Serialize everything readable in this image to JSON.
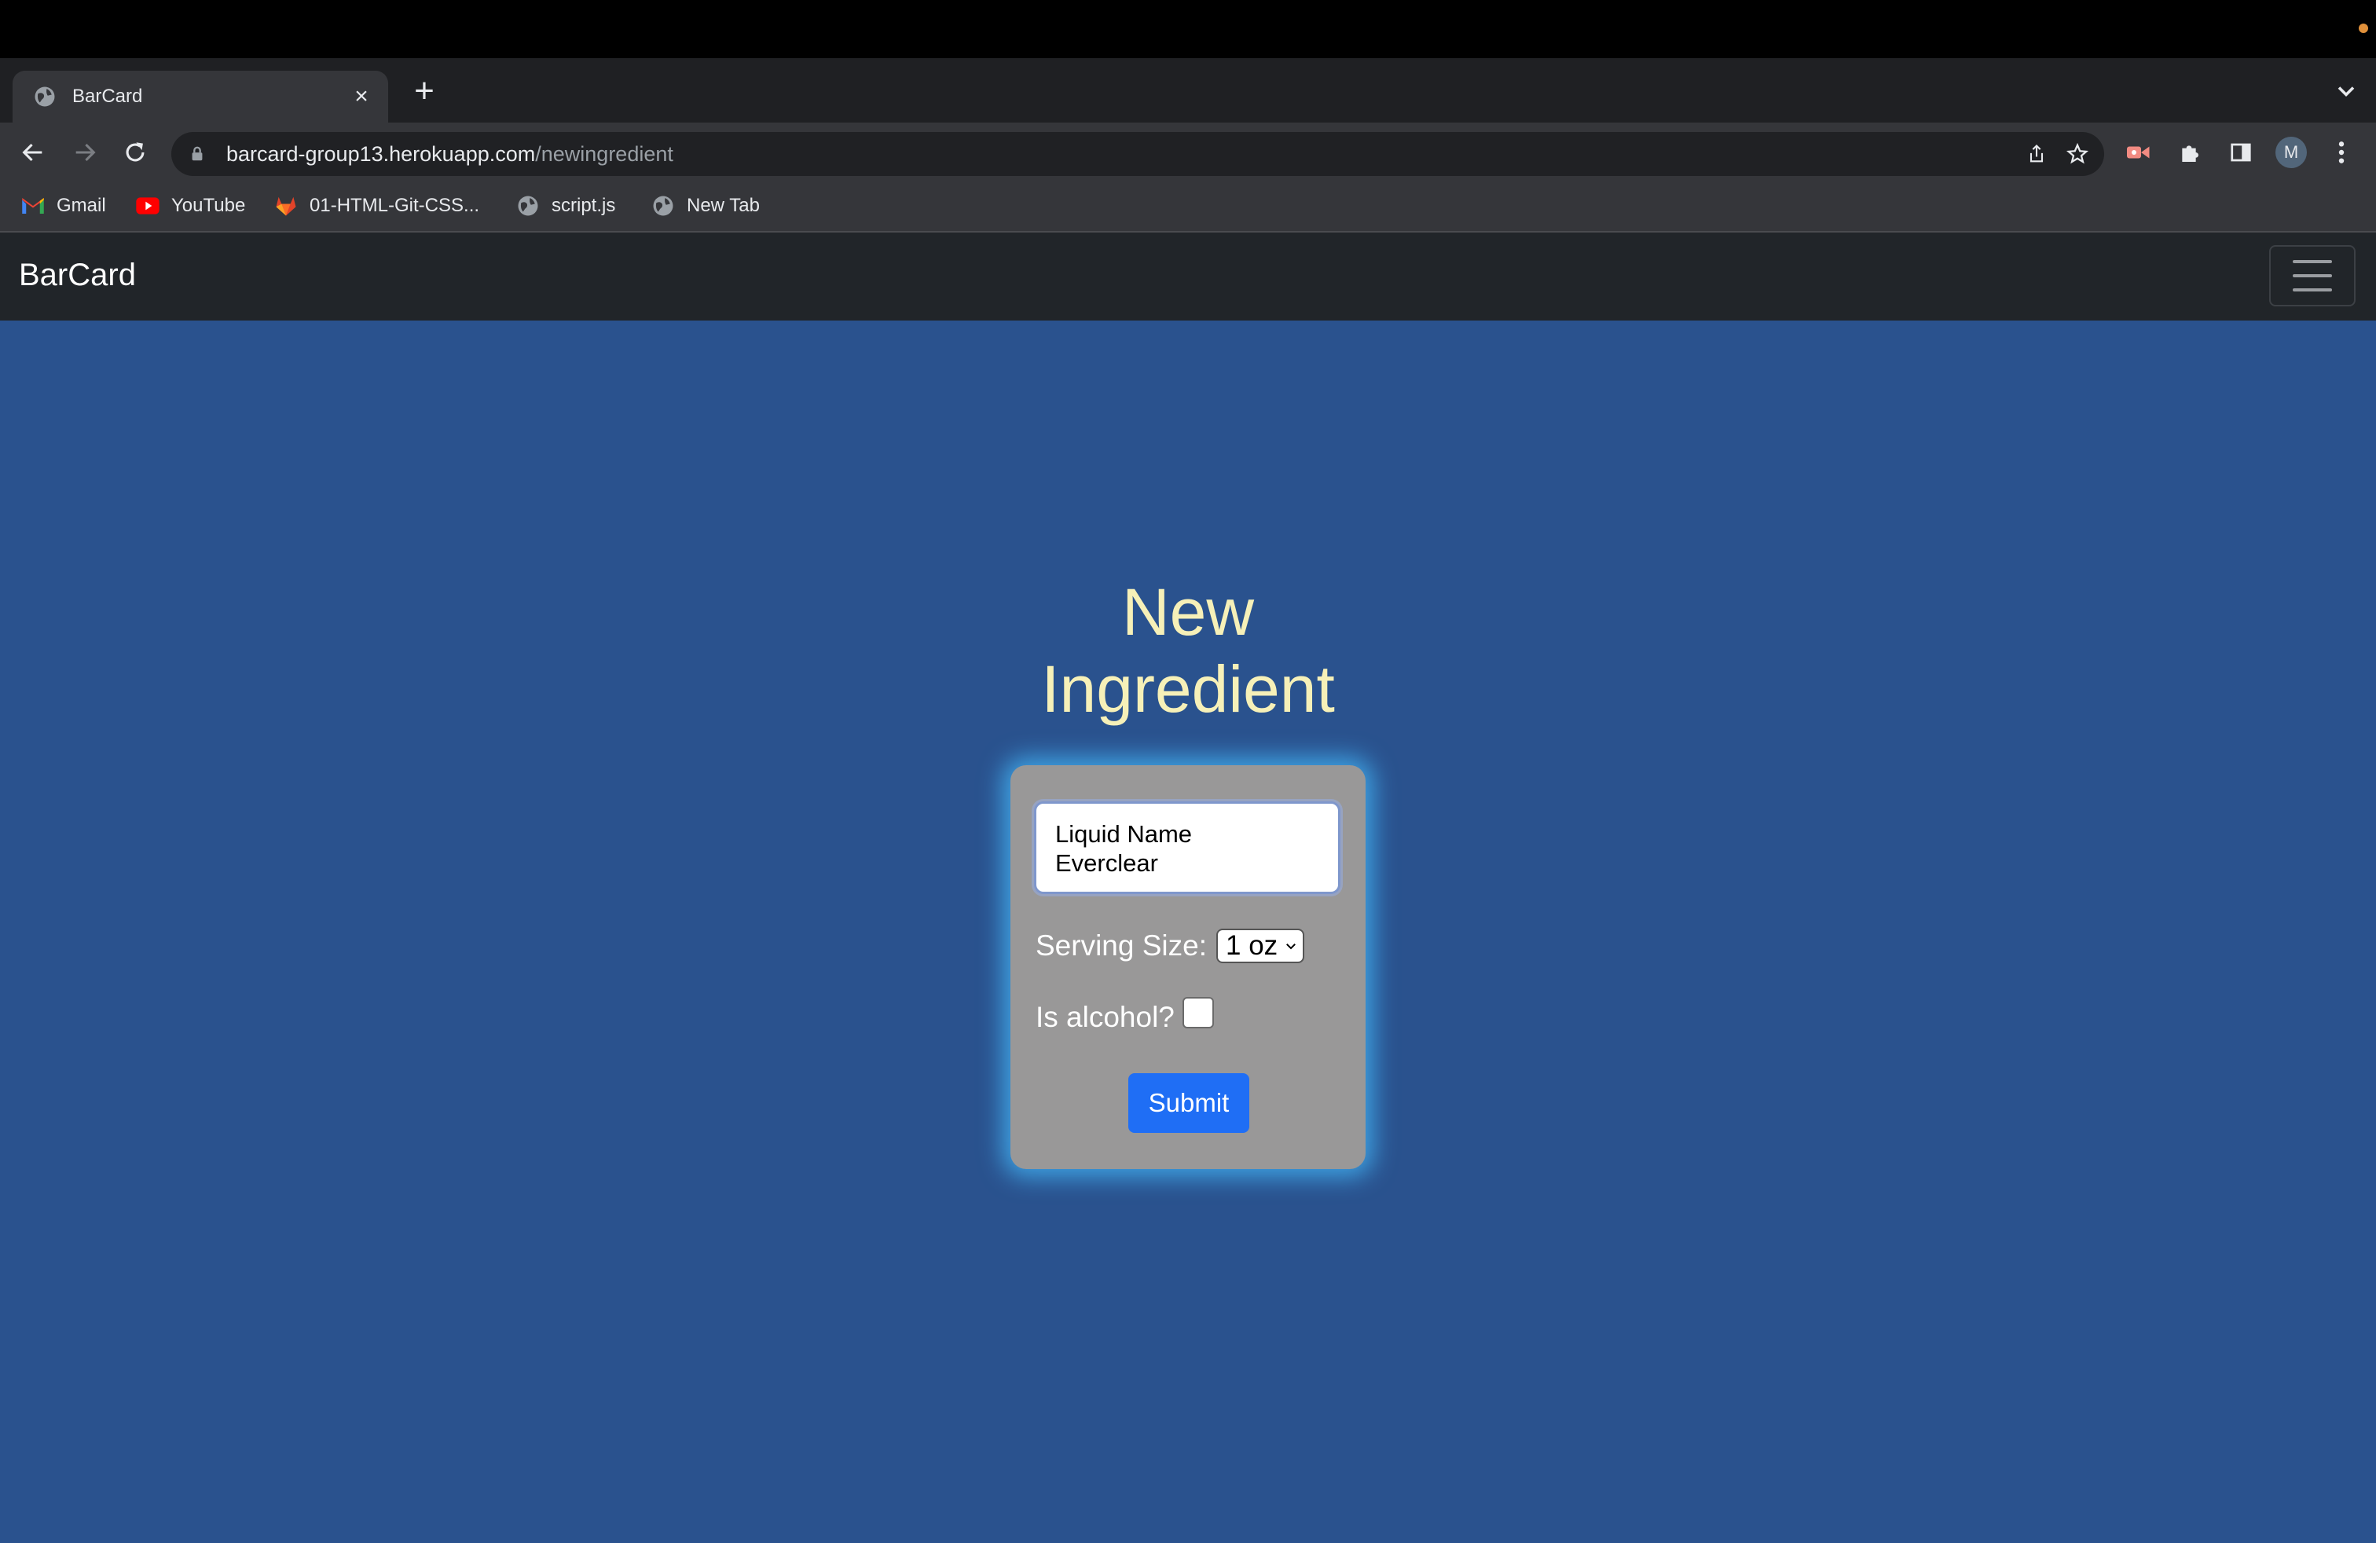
{
  "browser": {
    "tab": {
      "title": "BarCard",
      "close_icon": "×"
    },
    "new_tab_icon": "+",
    "omnibox": {
      "host": "barcard-group13.herokuapp.com",
      "path": "/newingredient"
    },
    "profile_initial": "M",
    "bookmarks": [
      {
        "label": "Gmail",
        "icon": "gmail-icon"
      },
      {
        "label": "YouTube",
        "icon": "youtube-icon"
      },
      {
        "label": "01-HTML-Git-CSS...",
        "icon": "gitlab-icon"
      },
      {
        "label": "script.js",
        "icon": "globe-icon"
      },
      {
        "label": "New Tab",
        "icon": "globe-icon"
      }
    ]
  },
  "site": {
    "brand": "BarCard",
    "heading_line1": "New",
    "heading_line2": "Ingredient",
    "form": {
      "liquid_label": "Liquid Name",
      "liquid_value": "Everclear",
      "serving_label": "Serving Size:",
      "serving_value": "1 oz",
      "alcohol_label": "Is alcohol?",
      "alcohol_checked": false,
      "submit_label": "Submit"
    }
  },
  "colors": {
    "page_background": "#2a528e",
    "heading": "#f6f0b8",
    "card": "#999898",
    "card_glow": "#46beff",
    "submit": "#1f6ef5",
    "navbar": "#212529"
  }
}
